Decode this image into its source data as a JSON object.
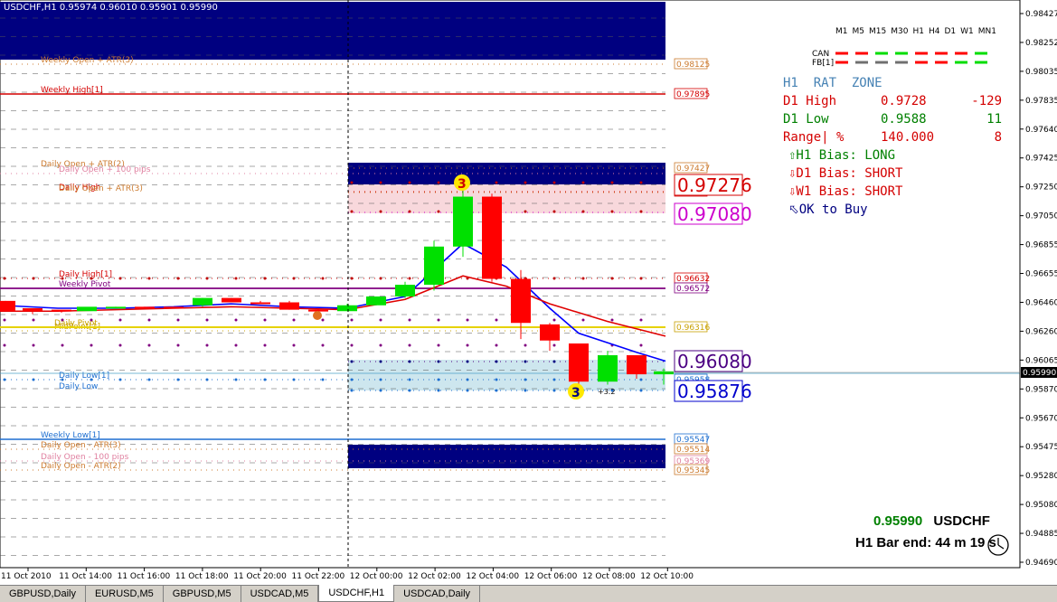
{
  "chart": {
    "caption": "USDCHF,H1  0.95974 0.96010 0.95901 0.95990",
    "current_price_tag": "0.95990",
    "price_ticks": [
      "0.98427",
      "0.98252",
      "0.98035",
      "0.97835",
      "0.97640",
      "0.97425",
      "0.97250",
      "0.97050",
      "0.96855",
      "0.96655",
      "0.96460",
      "0.96260",
      "0.96065",
      "0.95870",
      "0.95670",
      "0.95475",
      "0.95280",
      "0.95080",
      "0.94885",
      "0.94690"
    ],
    "time_ticks": [
      "11 Oct 2010",
      "11 Oct 14:00",
      "11 Oct 16:00",
      "11 Oct 18:00",
      "11 Oct 20:00",
      "11 Oct 22:00",
      "12 Oct 00:00",
      "12 Oct 02:00",
      "12 Oct 04:00",
      "12 Oct 06:00",
      "12 Oct 08:00",
      "12 Oct 10:00"
    ],
    "levels": [
      {
        "label": "Weekly Open + ATR(3)",
        "tag": "0.98125",
        "color": "#cc7a2e"
      },
      {
        "label": "Weekly High[1]",
        "tag": "0.97895",
        "color": "#d40000"
      },
      {
        "label": "Daily Open + ATR(2)",
        "tag": "0.97427",
        "color": "#cc7a2e"
      },
      {
        "label": "Daily Open + 100 pips",
        "tag": "",
        "color": "#e080a0"
      },
      {
        "label": "Daily High",
        "tag": "0.97276",
        "color": "#d40000"
      },
      {
        "label": "Daily Open + ATR(3)",
        "tag": "",
        "color": "#cc7a2e"
      },
      {
        "label": "",
        "tag": "0.97080",
        "color": "#cc00cc"
      },
      {
        "label": "Daily High[1]",
        "tag": "0.96632",
        "color": "#d40000"
      },
      {
        "label": "Weekly Pivot",
        "tag": "0.96572",
        "color": "#800080"
      },
      {
        "label": "Daily Pivot",
        "tag": "0.96316",
        "color": "#c8a000"
      },
      {
        "label": "MidPoint[1]",
        "tag": "",
        "color": "#c8a000"
      },
      {
        "label": "",
        "tag": "0.96080",
        "color": "#4b0082"
      },
      {
        "label": "Daily Low[1]",
        "tag": "0.95958",
        "color": "#1e6fd0"
      },
      {
        "label": "Daily Low",
        "tag": "0.95876",
        "color": "#1e6fd0"
      },
      {
        "label": "Weekly Low[1]",
        "tag": "0.95547",
        "color": "#1e6fd0"
      },
      {
        "label": "Daily Open - ATR(3)",
        "tag": "0.95514",
        "color": "#cc7a2e"
      },
      {
        "label": "Daily Open - 100 pips",
        "tag": "0.95369",
        "color": "#e080a0"
      },
      {
        "label": "Daily Open - ATR(2)",
        "tag": "0.95345",
        "color": "#cc7a2e"
      }
    ],
    "big_tags": {
      "high": "0.97276",
      "pink": "0.97080",
      "purple": "0.96080",
      "low": "0.95876"
    },
    "markers": {
      "top": "3",
      "bottom": "3",
      "small_note": "+3.2"
    }
  },
  "timeframes": [
    "M1",
    "M5",
    "M15",
    "M30",
    "H1",
    "H4",
    "D1",
    "W1",
    "MN1"
  ],
  "legend": {
    "can": "CAN",
    "fb": "FB[1]"
  },
  "info": {
    "title": "H1  RAT  ZONE",
    "d1_high_label": "D1 High",
    "d1_high_value": "0.9728",
    "d1_high_diff": "-129",
    "d1_low_label": "D1 Low",
    "d1_low_value": "0.9588",
    "d1_low_diff": "11",
    "range_label": "Range| %",
    "range_value": "140.000",
    "range_diff": "8",
    "h1_bias": "⇧H1 Bias: LONG",
    "d1_bias": "⇩D1 Bias: SHORT",
    "w1_bias": "⇩W1 Bias: SHORT",
    "signal": "⬁OK to Buy"
  },
  "price_display": {
    "price": "0.95990",
    "symbol": "USDCHF",
    "bar_end": "H1 Bar end: 44 m 19 s"
  },
  "tabs": [
    "GBPUSD,Daily",
    "EURUSD,M5",
    "GBPUSD,M5",
    "USDCAD,M5",
    "USDCHF,H1",
    "USDCAD,Daily"
  ],
  "active_tab": "USDCHF,H1",
  "colors": {
    "bull": "#00e000",
    "bear": "#ff0000",
    "navy": "#000080",
    "ma_blue": "#0000ff",
    "ma_red": "#e00000"
  }
}
